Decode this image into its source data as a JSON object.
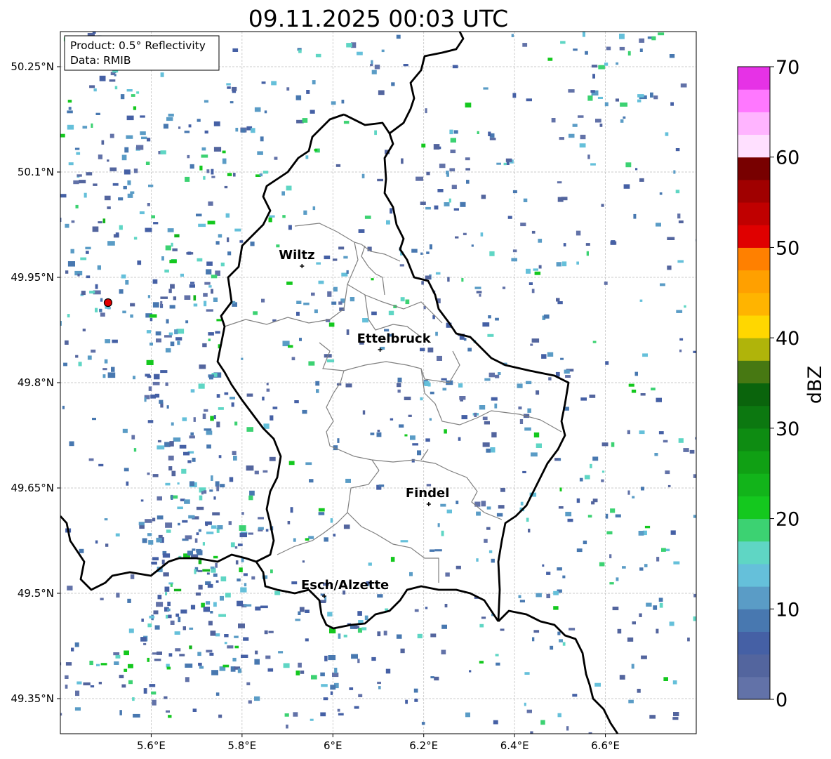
{
  "title": "09.11.2025 00:03 UTC",
  "info_box": {
    "product": "Product: 0.5° Reflectivity",
    "data_source": "Data: RMIB"
  },
  "map": {
    "lon_range": [
      5.4,
      6.8
    ],
    "lat_range": [
      49.3,
      50.3
    ],
    "x_ticks": [
      {
        "value": 5.6,
        "label": "5.6°E"
      },
      {
        "value": 5.8,
        "label": "5.8°E"
      },
      {
        "value": 6.0,
        "label": "6°E"
      },
      {
        "value": 6.2,
        "label": "6.2°E"
      },
      {
        "value": 6.4,
        "label": "6.4°E"
      },
      {
        "value": 6.6,
        "label": "6.6°E"
      }
    ],
    "y_ticks": [
      {
        "value": 50.25,
        "label": "50.25°N"
      },
      {
        "value": 50.1,
        "label": "50.1°N"
      },
      {
        "value": 49.95,
        "label": "49.95°N"
      },
      {
        "value": 49.8,
        "label": "49.8°N"
      },
      {
        "value": 49.65,
        "label": "49.65°N"
      },
      {
        "value": 49.5,
        "label": "49.5°N"
      },
      {
        "value": 49.35,
        "label": "49.35°N"
      }
    ],
    "grid": true,
    "radar_site": {
      "lon": 5.505,
      "lat": 49.914,
      "marker_color": "#e00000"
    },
    "cities": [
      {
        "name": "Wiltz",
        "lon": 5.932,
        "lat": 49.966
      },
      {
        "name": "Ettelbruck",
        "lon": 6.104,
        "lat": 49.847
      },
      {
        "name": "Findel",
        "lon": 6.211,
        "lat": 49.627
      },
      {
        "name": "Esch/Alzette",
        "lon": 5.981,
        "lat": 49.496
      }
    ]
  },
  "colorbar": {
    "label": "dBZ",
    "min": 0,
    "max": 70,
    "step": 2.5,
    "ticks": [
      "0",
      "10",
      "20",
      "30",
      "40",
      "50",
      "60",
      "70"
    ],
    "colors": [
      "#6272a8",
      "#53659e",
      "#4560a5",
      "#4878b0",
      "#5a9cc6",
      "#65c0da",
      "#5fd6c4",
      "#3cd272",
      "#14c81e",
      "#12b41a",
      "#10a014",
      "#0e8c12",
      "#0c7810",
      "#0a640c",
      "#477812",
      "#b0b40a",
      "#ffd700",
      "#ffb400",
      "#ffa000",
      "#ff8000",
      "#e00000",
      "#c00000",
      "#a00000",
      "#780000",
      "#ffe0ff",
      "#ffb4ff",
      "#ff78ff",
      "#e632e6"
    ]
  }
}
